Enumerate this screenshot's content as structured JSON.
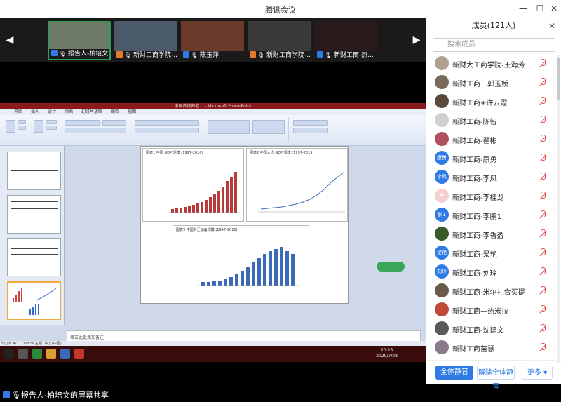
{
  "window": {
    "title": "腾讯会议"
  },
  "thumbnails": [
    {
      "name": "报告人-柏培文",
      "active": true,
      "color": "#6f7a66"
    },
    {
      "name": "新财工商学院-...",
      "active": false,
      "color": "#4a5a6a"
    },
    {
      "name": "陈玉萍",
      "active": false,
      "color": "#6a3a2a"
    },
    {
      "name": "新财工商学院-...",
      "active": false,
      "color": "#3a3a3a"
    },
    {
      "name": "新财工商-热...",
      "active": false,
      "color": "#2a1a1a"
    }
  ],
  "presentation": {
    "window_title": "中国传统养老... - Microsoft PowerPoint",
    "tabs": [
      "开始",
      "插入",
      "设计",
      "动画",
      "幻灯片放映",
      "审阅",
      "视图"
    ],
    "notes_placeholder": "单击此处添加备注",
    "status_text": "幻灯片 4/11  \"Office 主题\"  中文(中国)",
    "chart1_title": "图表1  中国 GDP 规模 (1997-2016)",
    "chart2_title": "图表2  中国人均 GDP 规模 (1997-2015)",
    "chart3_title": "图表3  中国外汇储备规模 (1997-2016)",
    "clock_time": "20:23",
    "clock_date": "2020/7/28"
  },
  "share_bar": {
    "text": "报告人-柏培文的屏幕共享"
  },
  "members_panel": {
    "title": "成员(121人)",
    "search_placeholder": "搜索成员",
    "members": [
      {
        "name": "新财大工商学院-王海芳",
        "avatar_text": "",
        "avatar_color": "#b0a090"
      },
      {
        "name": "新财工商　郭玉娇",
        "avatar_text": "",
        "avatar_color": "#7a6a5a"
      },
      {
        "name": "新财工商+许云霞",
        "avatar_text": "",
        "avatar_color": "#5a4a3a"
      },
      {
        "name": "新财工商-陈智",
        "avatar_text": "",
        "avatar_color": "#d0d0d0"
      },
      {
        "name": "新财工商-翟彬",
        "avatar_text": "",
        "avatar_color": "#b05060"
      },
      {
        "name": "新财工商-康勇",
        "avatar_text": "康勇",
        "avatar_color": "#2f7ae5"
      },
      {
        "name": "新财工商-李凤",
        "avatar_text": "李凤",
        "avatar_color": "#2f7ae5"
      },
      {
        "name": "新财工商-李桂龙",
        "avatar_text": "♥",
        "avatar_color": "#f4d0d0"
      },
      {
        "name": "新财工商-李鹏1",
        "avatar_text": "鹏1",
        "avatar_color": "#2f7ae5"
      },
      {
        "name": "新财工商-李香盈",
        "avatar_text": "",
        "avatar_color": "#3a5a2a"
      },
      {
        "name": "新财工商-梁艳",
        "avatar_text": "梁艳",
        "avatar_color": "#2f7ae5"
      },
      {
        "name": "新财工商-刘玲",
        "avatar_text": "刘玲",
        "avatar_color": "#2f7ae5"
      },
      {
        "name": "新财工商-米尔扎合买提",
        "avatar_text": "",
        "avatar_color": "#6a5a4a"
      },
      {
        "name": "新财工商—热米拉",
        "avatar_text": "",
        "avatar_color": "#c04a3a"
      },
      {
        "name": "新财工商-沈建文",
        "avatar_text": "",
        "avatar_color": "#5a5a5a"
      },
      {
        "name": "新财工商苗慧",
        "avatar_text": "",
        "avatar_color": "#8a7a8a"
      }
    ],
    "mute_all_label": "全体静音",
    "unmute_all_label": "解除全体静音",
    "more_label": "更多 ▾"
  },
  "colors": {
    "accent_blue": "#2f7ae5",
    "speaking_green": "#2d9d5a",
    "mute_red": "#e04a4a"
  }
}
